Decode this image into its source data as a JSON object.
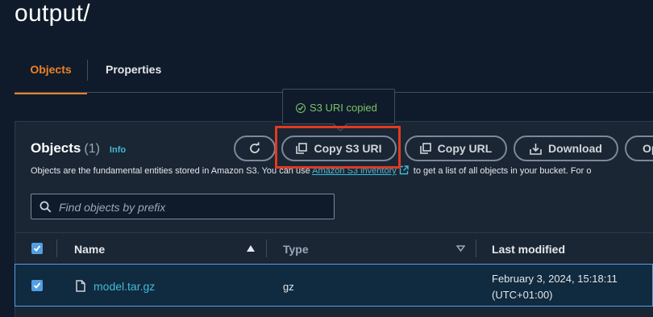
{
  "page": {
    "title": "output/"
  },
  "tabs": [
    {
      "label": "Objects"
    },
    {
      "label": "Properties"
    }
  ],
  "tooltip": {
    "text": "S3 URI copied"
  },
  "objects": {
    "title": "Objects",
    "count": "(1)",
    "info": "Info",
    "description_pre": "Objects are the fundamental entities stored in Amazon S3. You can use ",
    "description_link": "Amazon S3 inventory",
    "description_post": " to get a list of all objects in your bucket. For o"
  },
  "toolbar": {
    "copy_s3_uri": "Copy S3 URI",
    "copy_url": "Copy URL",
    "download": "Download",
    "more": "Op"
  },
  "search": {
    "placeholder": "Find objects by prefix"
  },
  "table": {
    "columns": {
      "name": "Name",
      "type": "Type",
      "last_modified": "Last modified"
    },
    "rows": [
      {
        "name": "model.tar.gz",
        "type": "gz",
        "modified_date": "February 3, 2024, 15:18:11",
        "modified_tz": "(UTC+01:00)"
      }
    ]
  },
  "colors": {
    "accent": "#ec8026",
    "link": "#44b9d6",
    "success": "#7cc46a",
    "highlight": "#e03a22",
    "selection": "#539fe5"
  }
}
